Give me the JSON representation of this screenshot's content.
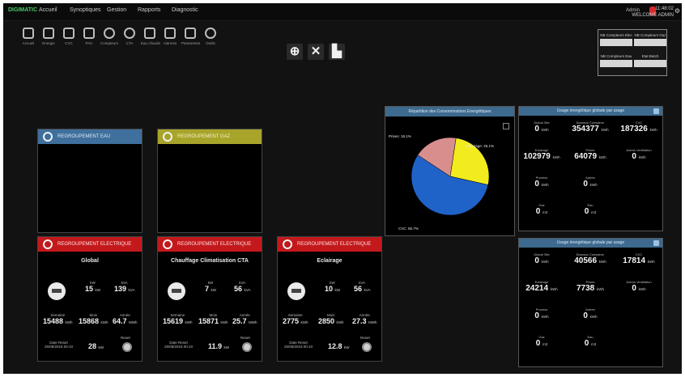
{
  "menubar": {
    "brand": "DIGIMATIC",
    "items": [
      "Accueil",
      "Synoptiques",
      "Gestion",
      "Rapports",
      "Diagnostic"
    ],
    "clock": "11:48:02",
    "date": "WELCOME ADMIN",
    "user": "Admin"
  },
  "toolbar": [
    {
      "icon": "home-icon",
      "label": "Accueil"
    },
    {
      "icon": "energy-icon",
      "label": "Energie"
    },
    {
      "icon": "cvc-icon",
      "label": "CVC"
    },
    {
      "icon": "pac-icon",
      "label": "PAC"
    },
    {
      "icon": "compteurs-icon",
      "label": "Compteurs"
    },
    {
      "icon": "cta-icon",
      "label": "CTA"
    },
    {
      "icon": "eau-chaude-icon",
      "label": "Eau chaude"
    },
    {
      "icon": "alarmes-icon",
      "label": "Alarmes"
    },
    {
      "icon": "parametres-icon",
      "label": "Parametres"
    },
    {
      "icon": "outils-icon",
      "label": "Outils"
    }
  ],
  "center_tools": [
    {
      "icon": "zoom-icon",
      "glyph": "⊕"
    },
    {
      "icon": "tools-icon",
      "glyph": "✕"
    },
    {
      "icon": "chart-icon",
      "glyph": "▙"
    }
  ],
  "indicators": [
    {
      "label": "NB Compteurs Elec",
      "value": ""
    },
    {
      "label": "NB Compteurs Gaz",
      "value": ""
    },
    {
      "label": "NB Compteurs Eau",
      "value": ""
    },
    {
      "label": "Etat Batch",
      "value": ""
    }
  ],
  "groups": {
    "eau": {
      "title": "REGROUPEMENT EAU"
    },
    "gaz": {
      "title": "REGROUPEMENT GAZ"
    }
  },
  "electric_groups": [
    {
      "title": "REGROUPEMENT ELECTRIQUE",
      "name": "Global",
      "p_label": "kW",
      "p_value": "15",
      "p_unit": "kW",
      "s_label": "kVA",
      "s_value": "139",
      "s_unit": "kVA",
      "a_label": "Semaine",
      "a_value": "15488",
      "a_unit": "kWh",
      "b_label": "Mois",
      "b_value": "15868",
      "b_unit": "kWh",
      "c_label": "Année",
      "c_value": "64.7",
      "c_unit": "MWh",
      "date_label": "Date Reset",
      "date_value": "25/08/2019 00:10",
      "d_value": "28",
      "d_unit": "kW",
      "vent_label": "Reset"
    },
    {
      "title": "REGROUPEMENT ELECTRIQUE",
      "name": "Chauffage Climatisation CTA",
      "p_label": "kW",
      "p_value": "7",
      "p_unit": "kW",
      "s_label": "kVA",
      "s_value": "56",
      "s_unit": "kVA",
      "a_label": "Semaine",
      "a_value": "15619",
      "a_unit": "kWh",
      "b_label": "Mois",
      "b_value": "15871",
      "b_unit": "kWh",
      "c_label": "Année",
      "c_value": "25.7",
      "c_unit": "MWh",
      "date_label": "Date Reset",
      "date_value": "25/08/2019 00:10",
      "d_value": "11.9",
      "d_unit": "kW",
      "vent_label": "Reset"
    },
    {
      "title": "REGROUPEMENT ELECTRIQUE",
      "name": "Eclairage",
      "p_label": "kW",
      "p_value": "10",
      "p_unit": "kW",
      "s_label": "kVA",
      "s_value": "56",
      "s_unit": "kVA",
      "a_label": "Semaine",
      "a_value": "2775",
      "a_unit": "kWh",
      "b_label": "Mois",
      "b_value": "2850",
      "b_unit": "kWh",
      "c_label": "Année",
      "c_value": "27.3",
      "c_unit": "MWh",
      "date_label": "Date Reset",
      "date_value": "25/08/2019 00:10",
      "d_value": "12.8",
      "d_unit": "kW",
      "vent_label": "Reset"
    }
  ],
  "pie": {
    "title": "Répartition des Consommations Energétiques",
    "labels": [
      {
        "text": "Eclairage: 26.1%"
      },
      {
        "text": "Prises: 18.1%"
      },
      {
        "text": "CVC: 55.7%"
      }
    ],
    "slices": [
      {
        "name": "Eclairage",
        "value": 26.1,
        "color": "#f2ec1e"
      },
      {
        "name": "CVC",
        "value": 55.7,
        "color": "#1f63c9"
      },
      {
        "name": "Prises",
        "value": 18.1,
        "color": "#d98e8e"
      }
    ]
  },
  "energy_panels": [
    {
      "title": "Usage énergétique globale par usage",
      "cells": [
        {
          "label": "Global Site",
          "value": "0",
          "unit": "kWh"
        },
        {
          "label": "Bureaux Complexe",
          "value": "354377",
          "unit": "kWh"
        },
        {
          "label": "CVC",
          "value": "187326",
          "unit": "kWh"
        },
        {
          "label": "Eclairage",
          "value": "102979",
          "unit": "kWh"
        },
        {
          "label": "Prises",
          "value": "64079",
          "unit": "kWh"
        },
        {
          "label": "Autres Ventilation",
          "value": "0",
          "unit": "kWh"
        },
        {
          "label": "Process",
          "value": "0",
          "unit": "kWh"
        },
        {
          "label": "Autres",
          "value": "0",
          "unit": "kWh"
        },
        {
          "label": "Gaz",
          "value": "0",
          "unit": "m3"
        },
        {
          "label": "Eau",
          "value": "0",
          "unit": "m3"
        }
      ]
    },
    {
      "title": "Usage énergétique globale par usage",
      "cells": [
        {
          "label": "Global Site",
          "value": "0",
          "unit": "kWh"
        },
        {
          "label": "Bureaux Complexe",
          "value": "40566",
          "unit": "kWh"
        },
        {
          "label": "CVC",
          "value": "17814",
          "unit": "kWh"
        },
        {
          "label": "Eclairage",
          "value": "24214",
          "unit": "kWh"
        },
        {
          "label": "Prises",
          "value": "7738",
          "unit": "kWh"
        },
        {
          "label": "Autres Ventilation",
          "value": "0",
          "unit": "kWh"
        },
        {
          "label": "Process",
          "value": "0",
          "unit": "kWh"
        },
        {
          "label": "Autres",
          "value": "0",
          "unit": "kWh"
        },
        {
          "label": "Gaz",
          "value": "0",
          "unit": "m3"
        },
        {
          "label": "Eau",
          "value": "0",
          "unit": "m3"
        }
      ]
    }
  ]
}
